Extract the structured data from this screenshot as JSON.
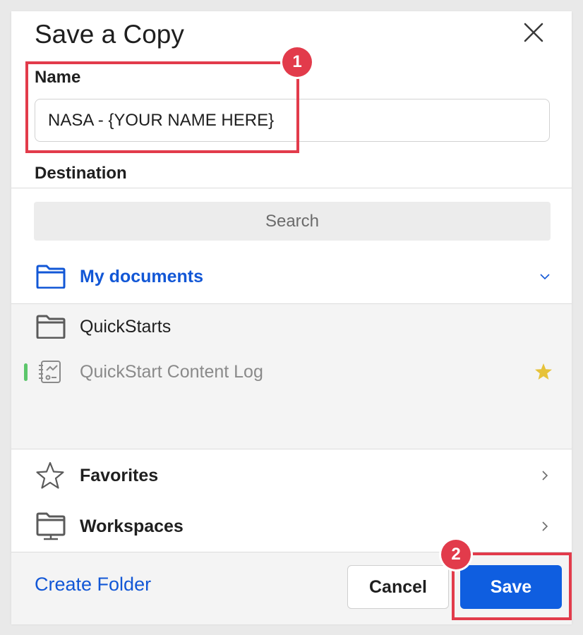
{
  "dialog": {
    "title": "Save a Copy",
    "close_icon": "close-icon"
  },
  "name_field": {
    "label": "Name",
    "value": "NASA - {YOUR NAME HERE}"
  },
  "destination": {
    "label": "Destination",
    "search_placeholder": "Search",
    "my_documents": {
      "label": "My documents",
      "icon": "folder-icon",
      "expanded": true
    },
    "children": [
      {
        "label": "QuickStarts",
        "icon": "folder-icon"
      },
      {
        "label": "QuickStart Content Log",
        "icon": "workbook-icon",
        "favorite": true
      }
    ],
    "favorites": {
      "label": "Favorites",
      "icon": "star-icon"
    },
    "workspaces": {
      "label": "Workspaces",
      "icon": "workspace-folder-icon"
    }
  },
  "footer": {
    "create_folder": "Create Folder",
    "cancel": "Cancel",
    "save": "Save"
  },
  "annotations": [
    {
      "number": "1",
      "target": "name-field"
    },
    {
      "number": "2",
      "target": "save-button"
    }
  ],
  "colors": {
    "accent": "#1257d6",
    "primary_button": "#0f5ee0",
    "annotation": "#e23b4b",
    "star": "#e6c23a",
    "active_indicator": "#5cc66b"
  }
}
